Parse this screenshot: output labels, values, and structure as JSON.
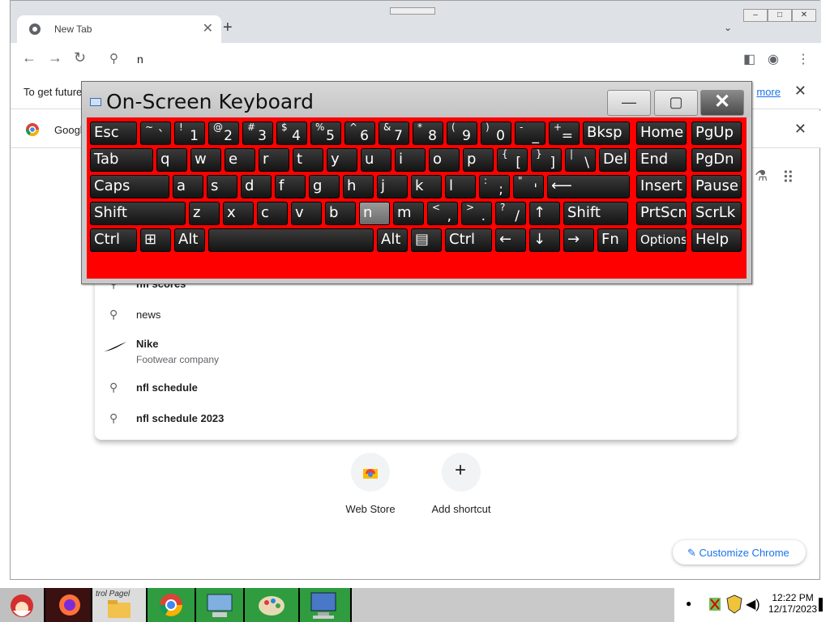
{
  "browser": {
    "tab_title": "New Tab",
    "tab_close": "✕",
    "new_tab": "+",
    "tab_list": "⌄",
    "window_buttons": [
      "–",
      "□",
      "✕"
    ],
    "omnibox_query": "n",
    "infobar_text": "To get future",
    "infobar_link": "more",
    "infobar2_text": "Googl"
  },
  "suggestions": [
    {
      "query": "nfl scores",
      "sub": ""
    },
    {
      "query": "news",
      "sub": ""
    },
    {
      "query": "Nike",
      "sub": "Footwear company"
    },
    {
      "query": "nfl schedule",
      "sub": ""
    },
    {
      "query": "nfl schedule 2023",
      "sub": ""
    }
  ],
  "shortcuts": [
    {
      "label": "Web Store"
    },
    {
      "label": "Add shortcut"
    }
  ],
  "customize_label": "Customize Chrome",
  "osk": {
    "title": "On-Screen Keyboard",
    "minimize": "—",
    "restore": "▢",
    "close": "✕",
    "pressed_key": "n",
    "rows": [
      [
        {
          "m": "Esc"
        },
        {
          "s": "~",
          "b": "`"
        },
        {
          "s": "!",
          "b": "1"
        },
        {
          "s": "@",
          "b": "2"
        },
        {
          "s": "#",
          "b": "3"
        },
        {
          "s": "$",
          "b": "4"
        },
        {
          "s": "%",
          "b": "5"
        },
        {
          "s": "^",
          "b": "6"
        },
        {
          "s": "&",
          "b": "7"
        },
        {
          "s": "*",
          "b": "8"
        },
        {
          "s": "(",
          "b": "9"
        },
        {
          "s": ")",
          "b": "0"
        },
        {
          "s": "-",
          "b": "_"
        },
        {
          "s": "+",
          "b": "="
        },
        {
          "m": "Bksp"
        },
        {
          "m": "Home"
        },
        {
          "m": "PgUp"
        }
      ],
      [
        {
          "m": "Tab"
        },
        {
          "m": "q"
        },
        {
          "m": "w"
        },
        {
          "m": "e"
        },
        {
          "m": "r"
        },
        {
          "m": "t"
        },
        {
          "m": "y"
        },
        {
          "m": "u"
        },
        {
          "m": "i"
        },
        {
          "m": "o"
        },
        {
          "m": "p"
        },
        {
          "s": "{",
          "b": "["
        },
        {
          "s": "}",
          "b": "]"
        },
        {
          "s": "|",
          "b": "\\"
        },
        {
          "m": "Del"
        },
        {
          "m": "End"
        },
        {
          "m": "PgDn"
        }
      ],
      [
        {
          "m": "Caps"
        },
        {
          "m": "a"
        },
        {
          "m": "s"
        },
        {
          "m": "d"
        },
        {
          "m": "f"
        },
        {
          "m": "g"
        },
        {
          "m": "h"
        },
        {
          "m": "j"
        },
        {
          "m": "k"
        },
        {
          "m": "l"
        },
        {
          "s": ":",
          "b": ";"
        },
        {
          "s": "\"",
          "b": "'"
        },
        {
          "m": "⟵"
        },
        {
          "m": "Insert"
        },
        {
          "m": "Pause"
        }
      ],
      [
        {
          "m": "Shift"
        },
        {
          "m": "z"
        },
        {
          "m": "x"
        },
        {
          "m": "c"
        },
        {
          "m": "v"
        },
        {
          "m": "b"
        },
        {
          "m": "n"
        },
        {
          "m": "m"
        },
        {
          "s": "<",
          "b": ","
        },
        {
          "s": ">",
          "b": "."
        },
        {
          "s": "?",
          "b": "/"
        },
        {
          "m": "↑"
        },
        {
          "m": "Shift"
        },
        {
          "m": "PrtScn"
        },
        {
          "m": "ScrLk"
        }
      ],
      [
        {
          "m": "Ctrl"
        },
        {
          "m": "⊞"
        },
        {
          "m": "Alt"
        },
        {
          "m": ""
        },
        {
          "m": "Alt"
        },
        {
          "m": "▤"
        },
        {
          "m": "Ctrl"
        },
        {
          "m": "←"
        },
        {
          "m": "↓"
        },
        {
          "m": "→"
        },
        {
          "m": "Fn"
        },
        {
          "m": "Options"
        },
        {
          "m": "Help"
        }
      ]
    ]
  },
  "taskbar": {
    "time": "12:22 PM",
    "date": "12/17/2023",
    "ctrl_label": "trol Pagel"
  }
}
